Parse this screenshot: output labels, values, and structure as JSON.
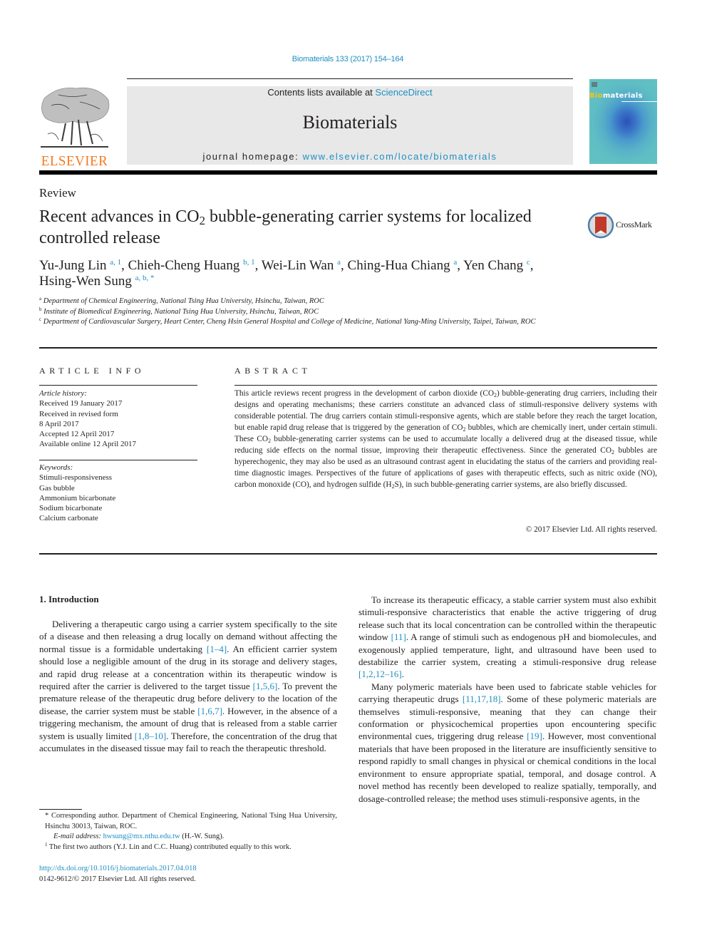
{
  "header": {
    "citation": "Biomaterials 133 (2017) 154–164",
    "publisher_wordmark": "ELSEVIER",
    "contents_prefix": "Contents lists available at ",
    "contents_link": "ScienceDirect",
    "journal_name": "Biomaterials",
    "homepage_prefix": "journal homepage: ",
    "homepage_link": "www.elsevier.com/locate/biomaterials",
    "cover": {
      "title_highlight": "Bio",
      "title_rest": "materials"
    },
    "crossmark_label": "CrossMark"
  },
  "article": {
    "type": "Review",
    "title_part1": "Recent advances in CO",
    "title_sub": "2",
    "title_part2": " bubble-generating carrier systems for localized controlled release",
    "authors": [
      {
        "name": "Yu-Jung Lin",
        "sup": "a, 1",
        "sep": ", "
      },
      {
        "name": "Chieh-Cheng Huang",
        "sup": "b, 1",
        "sep": ", "
      },
      {
        "name": "Wei-Lin Wan",
        "sup": "a",
        "sep": ", "
      },
      {
        "name": "Ching-Hua Chiang",
        "sup": "a",
        "sep": ", "
      },
      {
        "name": "Yen Chang",
        "sup": "c",
        "sep": ","
      },
      {
        "name": "Hsing-Wen Sung",
        "sup": "a, b, *",
        "sep": ""
      }
    ],
    "affiliations": [
      {
        "key": "a",
        "text": "Department of Chemical Engineering, National Tsing Hua University, Hsinchu, Taiwan, ROC"
      },
      {
        "key": "b",
        "text": "Institute of Biomedical Engineering, National Tsing Hua University, Hsinchu, Taiwan, ROC"
      },
      {
        "key": "c",
        "text": "Department of Cardiovascular Surgery, Heart Center, Cheng Hsin General Hospital and College of Medicine, National Yang-Ming University, Taipei, Taiwan, ROC"
      }
    ]
  },
  "article_info": {
    "heading": "ARTICLE INFO",
    "history_label": "Article history:",
    "history": [
      "Received 19 January 2017",
      "Received in revised form",
      "8 April 2017",
      "Accepted 12 April 2017",
      "Available online 12 April 2017"
    ],
    "keywords_label": "Keywords:",
    "keywords": [
      "Stimuli-responsiveness",
      "Gas bubble",
      "Ammonium bicarbonate",
      "Sodium bicarbonate",
      "Calcium carbonate"
    ]
  },
  "abstract": {
    "heading": "ABSTRACT",
    "segments": [
      "This article reviews recent progress in the development of carbon dioxide (CO",
      "2",
      ") bubble-generating drug carriers, including their designs and operating mechanisms; these carriers constitute an advanced class of stimuli-responsive delivery systems with considerable potential. The drug carriers contain stimuli-responsive agents, which are stable before they reach the target location, but enable rapid drug release that is triggered by the generation of CO",
      "2",
      " bubbles, which are chemically inert, under certain stimuli. These CO",
      "2",
      " bubble-generating carrier systems can be used to accumulate locally a delivered drug at the diseased tissue, while reducing side effects on the normal tissue, improving their therapeutic effectiveness. Since the generated CO",
      "2",
      " bubbles are hyperechogenic, they may also be used as an ultrasound contrast agent in elucidating the status of the carriers and providing real-time diagnostic images. Perspectives of the future of applications of gases with therapeutic effects, such as nitric oxide (NO), carbon monoxide (CO), and hydrogen sulfide (H",
      "2",
      "S), in such bubble-generating carrier systems, are also briefly discussed."
    ],
    "copyright": "© 2017 Elsevier Ltd. All rights reserved."
  },
  "body": {
    "section_heading": "1.  Introduction",
    "left_paragraph": [
      {
        "t": "Delivering a therapeutic cargo using a carrier system specifically to the site of a disease and then releasing a drug locally on demand without affecting the normal tissue is a formidable undertaking "
      },
      {
        "ref": "[1–4]"
      },
      {
        "t": ". An efficient carrier system should lose a negligible amount of the drug in its storage and delivery stages, and rapid drug release at a concentration within its therapeutic window is required after the carrier is delivered to the target tissue "
      },
      {
        "ref": "[1,5,6]"
      },
      {
        "t": ". To prevent the premature release of the therapeutic drug before delivery to the location of the disease, the carrier system must be stable "
      },
      {
        "ref": "[1,6,7]"
      },
      {
        "t": ". However, in the absence of a triggering mechanism, the amount of drug that is released from a stable carrier system is usually limited "
      },
      {
        "ref": "[1,8–10]"
      },
      {
        "t": ". Therefore, the concentration of the drug that accumulates in the diseased tissue may fail to reach the therapeutic threshold."
      }
    ],
    "right_paragraph_1": [
      {
        "t": "To increase its therapeutic efficacy, a stable carrier system must also exhibit stimuli-responsive characteristics that enable the active triggering of drug release such that its local concentration can be controlled within the therapeutic window "
      },
      {
        "ref": "[11]"
      },
      {
        "t": ". A range of stimuli such as endogenous pH and biomolecules, and exogenously applied temperature, light, and ultrasound have been used to destabilize the carrier system, creating a stimuli-responsive drug release "
      },
      {
        "ref": "[1,2,12–16]"
      },
      {
        "t": "."
      }
    ],
    "right_paragraph_2": [
      {
        "t": "Many polymeric materials have been used to fabricate stable vehicles for carrying therapeutic drugs "
      },
      {
        "ref": "[11,17,18]"
      },
      {
        "t": ". Some of these polymeric materials are themselves stimuli-responsive, meaning that they can change their conformation or physicochemical properties upon encountering specific environmental cues, triggering drug release "
      },
      {
        "ref": "[19]"
      },
      {
        "t": ". However, most conventional materials that have been proposed in the literature are insufficiently sensitive to respond rapidly to small changes in physical or chemical conditions in the local environment to ensure appropriate spatial, temporal, and dosage control. A novel method has recently been developed to realize spatially, temporally, and dosage-controlled release; the method uses stimuli-responsive agents, in the"
      }
    ]
  },
  "footnotes": {
    "corresponding": "* Corresponding author. Department of Chemical Engineering, National Tsing Hua University, Hsinchu 30013, Taiwan, ROC.",
    "email_label": "E-mail address: ",
    "email": "hwsung@mx.nthu.edu.tw",
    "email_suffix": " (H.-W. Sung).",
    "equal_mark": "1",
    "equal_text": " The first two authors (Y.J. Lin and C.C. Huang) contributed equally to this work.",
    "doi": "http://dx.doi.org/10.1016/j.biomaterials.2017.04.018",
    "issn": "0142-9612/© 2017 Elsevier Ltd. All rights reserved."
  },
  "colors": {
    "link": "#1f8fc1",
    "elsevier_orange": "#f47920",
    "banner_gray": "#e8e8e9",
    "text": "#231f20"
  }
}
